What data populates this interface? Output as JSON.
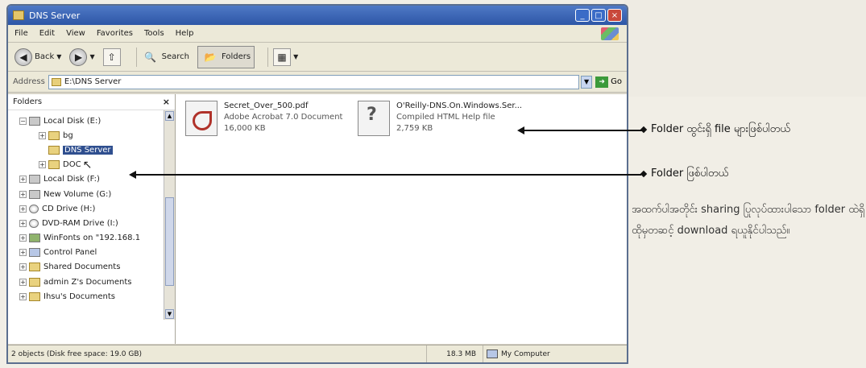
{
  "window": {
    "title": "DNS Server"
  },
  "menu": [
    "File",
    "Edit",
    "View",
    "Favorites",
    "Tools",
    "Help"
  ],
  "toolbar": {
    "back": "Back",
    "search": "Search",
    "folders": "Folders"
  },
  "address": {
    "label": "Address",
    "value": "E:\\DNS Server",
    "go": "Go"
  },
  "folders_pane": {
    "title": "Folders",
    "tree": [
      {
        "label": "Local Disk (E:)",
        "expander": "⊟",
        "icon": "drive",
        "indent": 0
      },
      {
        "label": "bg",
        "expander": "⊞",
        "icon": "folder",
        "indent": 1
      },
      {
        "label": "DNS Server",
        "expander": "",
        "icon": "folder",
        "indent": 1,
        "selected": true
      },
      {
        "label": "DOC",
        "expander": "⊞",
        "icon": "folder",
        "indent": 1
      },
      {
        "label": "Local Disk (F:)",
        "expander": "⊞",
        "icon": "drive",
        "indent": 0
      },
      {
        "label": "New Volume (G:)",
        "expander": "⊞",
        "icon": "drive",
        "indent": 0
      },
      {
        "label": "CD Drive (H:)",
        "expander": "⊞",
        "icon": "cd",
        "indent": 0
      },
      {
        "label": "DVD-RAM Drive (I:)",
        "expander": "⊞",
        "icon": "cd",
        "indent": 0
      },
      {
        "label": "WinFonts on \"192.168.1",
        "expander": "⊞",
        "icon": "net",
        "indent": 0
      },
      {
        "label": "Control Panel",
        "expander": "⊞",
        "icon": "panel",
        "indent": 0
      },
      {
        "label": "Shared Documents",
        "expander": "⊞",
        "icon": "folder",
        "indent": 0
      },
      {
        "label": "admin Z's Documents",
        "expander": "⊞",
        "icon": "folder",
        "indent": 0
      },
      {
        "label": "Ihsu's Documents",
        "expander": "⊞",
        "icon": "folder",
        "indent": 0
      }
    ]
  },
  "files": [
    {
      "name": "Secret_Over_500.pdf",
      "type": "Adobe Acrobat 7.0 Document",
      "size": "16,000 KB",
      "icon": "pdf-icon"
    },
    {
      "name": "O'Reilly-DNS.On.Windows.Ser...",
      "type": "Compiled HTML Help file",
      "size": "2,759 KB",
      "icon": "chm-help-icon"
    }
  ],
  "statusbar": {
    "objects": "2 objects (Disk free space: 19.0 GB)",
    "size": "18.3 MB",
    "location": "My Computer"
  },
  "annotations": {
    "files_in_folder": "Folder ထွင်းရှိ file များဖြစ်ပါတယ်",
    "folder": "Folder ဖြစ်ပါတယ်"
  },
  "page_text": {
    "lines": [
      "အထက်ပါအတိုင်း sharing ပြုလုပ်ထားပါသော folder ထဲရှိ file များကို copy ကူးယူအသုံးပြုနိုင်ပါတယ်။ www.",
      "ထိုမှတဆင့် download ရယူနိုင်ပါသည်။"
    ]
  }
}
